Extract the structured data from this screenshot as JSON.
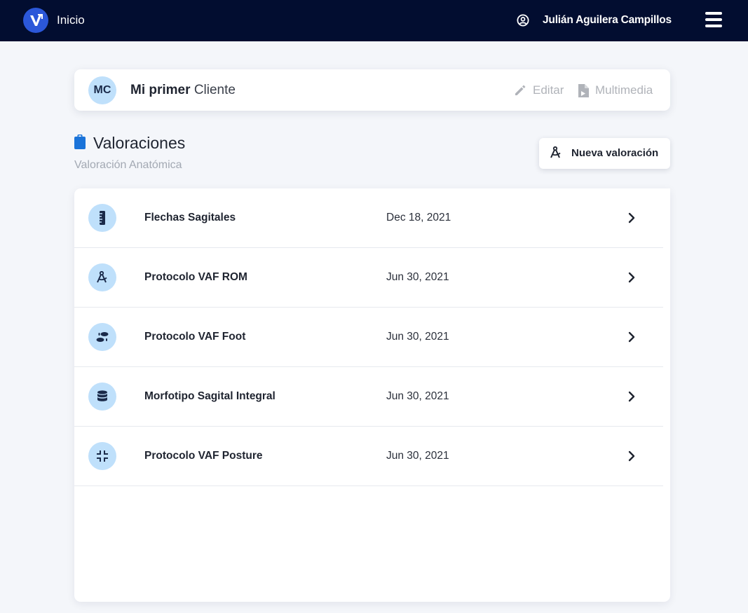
{
  "topbar": {
    "home_label": "Inicio",
    "user_name": "Julián Aguilera Campillos"
  },
  "client": {
    "initials": "MC",
    "first_name": "Mi primer",
    "last_name": "Cliente",
    "edit_label": "Editar",
    "media_label": "Multimedia"
  },
  "section": {
    "title": "Valoraciones",
    "subtitle": "Valoración Anatómica",
    "new_button_label": "Nueva valoración"
  },
  "assessments": [
    {
      "icon": "ruler-vertical-icon",
      "title": "Flechas Sagitales",
      "date": "Dec 18, 2021"
    },
    {
      "icon": "compass-drafting-icon",
      "title": "Protocolo VAF ROM",
      "date": "Jun 30, 2021"
    },
    {
      "icon": "footprints-icon",
      "title": "Protocolo VAF Foot",
      "date": "Jun 30, 2021"
    },
    {
      "icon": "database-icon",
      "title": "Morfotipo Sagital Integral",
      "date": "Jun 30, 2021"
    },
    {
      "icon": "compress-icon",
      "title": "Protocolo VAF Posture",
      "date": "Jun 30, 2021"
    }
  ],
  "colors": {
    "navbar": "#020d30",
    "accent": "#2b57d9",
    "icon_circle": "#bfe0fb",
    "section_icon": "#1a73d9"
  }
}
